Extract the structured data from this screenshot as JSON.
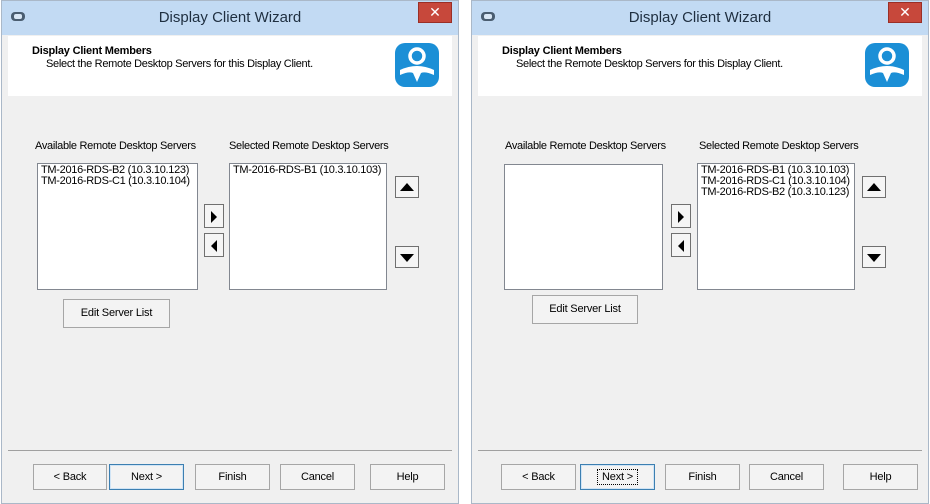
{
  "windows": [
    {
      "title": "Display Client Wizard",
      "header": {
        "title": "Display Client Members",
        "subtitle": "Select the Remote Desktop Servers for this Display Client."
      },
      "available_label": "Available Remote Desktop Servers",
      "selected_label": "Selected Remote Desktop Servers",
      "available": [
        "TM-2016-RDS-B2 (10.3.10.123)",
        "TM-2016-RDS-C1 (10.3.10.104)"
      ],
      "selected": [
        "TM-2016-RDS-B1 (10.3.10.103)"
      ],
      "edit_button": "Edit Server List",
      "buttons": {
        "back": "< Back",
        "next": "Next >",
        "finish": "Finish",
        "cancel": "Cancel",
        "help": "Help"
      }
    },
    {
      "title": "Display Client Wizard",
      "header": {
        "title": "Display Client Members",
        "subtitle": "Select the Remote Desktop Servers for this Display Client."
      },
      "available_label": "Available Remote Desktop Servers",
      "selected_label": "Selected Remote Desktop Servers",
      "available": [],
      "selected": [
        "TM-2016-RDS-B1 (10.3.10.103)",
        "TM-2016-RDS-C1 (10.3.10.104)",
        "TM-2016-RDS-B2 (10.3.10.123)"
      ],
      "edit_button": "Edit Server List",
      "buttons": {
        "back": "< Back",
        "next": "Next >",
        "finish": "Finish",
        "cancel": "Cancel",
        "help": "Help"
      }
    }
  ],
  "colors": {
    "titlebar": "#c2daf3",
    "close": "#c7483b",
    "logo": "#1b8fd6",
    "dialog": "#f0f0f0"
  },
  "icons": {
    "app": "window-app-icon",
    "close": "close-icon",
    "logo": "thinmanager-logo-icon",
    "right": "arrow-right-icon",
    "left": "arrow-left-icon",
    "up": "arrow-up-icon",
    "down": "arrow-down-icon"
  }
}
